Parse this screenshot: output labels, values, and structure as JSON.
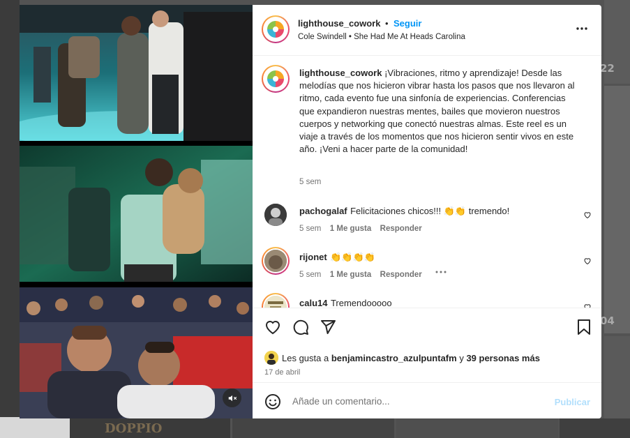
{
  "post": {
    "username": "lighthouse_cowork",
    "separator": "•",
    "follow_label": "Seguir",
    "audio": "Cole Swindell • She Had Me At Heads Carolina",
    "caption": "¡Vibraciones, ritmo y aprendizaje! Desde las melodías que nos hicieron vibrar hasta los pasos que nos llevaron al ritmo, cada evento fue una sinfonía de experiencias. Conferencias que expandieron nuestras mentes, bailes que movieron nuestros cuerpos y networking que conectó nuestras almas. Este reel es un viaje a través de los momentos que nos hicieron sentir vivos en este año. ¡Veni a hacer parte de la comunidad!",
    "caption_time": "5 sem"
  },
  "comments": [
    {
      "username": "pachogalaf",
      "text": "Felicitaciones chicos!!! 👏👏 tremendo!",
      "time": "5 sem",
      "likes": "1 Me gusta",
      "reply": "Responder"
    },
    {
      "username": "rijonet",
      "text": "👏👏👏👏",
      "time": "5 sem",
      "likes": "1 Me gusta",
      "reply": "Responder"
    },
    {
      "username": "calu14",
      "text": "Tremendooooo"
    }
  ],
  "likes_line": {
    "prefix": "Les gusta a ",
    "user": "benjamincastro_azulpuntafm",
    "middle": " y ",
    "others": "39 personas más"
  },
  "date": "17 de abril",
  "add_comment": {
    "placeholder": "Añade un comentario...",
    "publish": "Publicar"
  },
  "background": {
    "num_1": "22",
    "num_2": "04",
    "shop_sign": "DOPPIO"
  },
  "icons": {
    "more": "more-options-icon",
    "heart": "heart-icon",
    "comment": "comment-icon",
    "share": "share-icon",
    "save": "bookmark-icon",
    "emoji": "emoji-icon",
    "mute": "mute-icon"
  },
  "colors": {
    "link": "#0095f6",
    "publish_disabled": "#b2dffc",
    "text": "#262626",
    "meta": "#737373"
  }
}
